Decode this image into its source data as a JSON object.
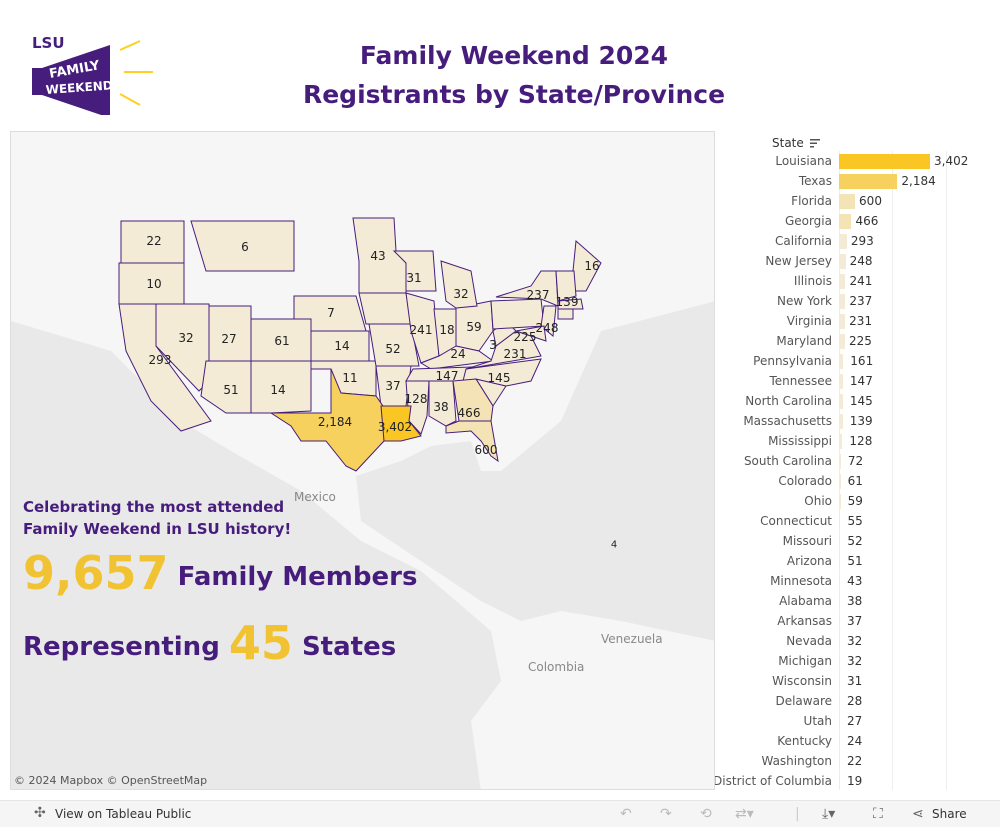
{
  "logo": {
    "text_top": "LSU",
    "text_mid": "FAMILY",
    "text_bot": "WEEKEND",
    "color": "#461d7c",
    "accent": "#fdd023"
  },
  "title": {
    "line1": "Family Weekend 2024",
    "line2": "Registrants by State/Province"
  },
  "map": {
    "labels": [
      {
        "state": "Washington",
        "value": "22"
      },
      {
        "state": "Oregon",
        "value": "10"
      },
      {
        "state": "Montana",
        "value": "6"
      },
      {
        "state": "Minnesota",
        "value": "43"
      },
      {
        "state": "Wisconsin",
        "value": "31"
      },
      {
        "state": "Michigan",
        "value": "32"
      },
      {
        "state": "New York",
        "value": "237"
      },
      {
        "state": "Maine",
        "value": "16"
      },
      {
        "state": "Massachusetts",
        "value": "139"
      },
      {
        "state": "California",
        "value": "293"
      },
      {
        "state": "Nevada",
        "value": "32"
      },
      {
        "state": "Utah",
        "value": "27"
      },
      {
        "state": "Colorado",
        "value": "61"
      },
      {
        "state": "Nebraska",
        "value": "7"
      },
      {
        "state": "Kansas",
        "value": "14"
      },
      {
        "state": "Missouri",
        "value": "52"
      },
      {
        "state": "Illinois",
        "value": "241"
      },
      {
        "state": "Indiana",
        "value": "18"
      },
      {
        "state": "Ohio",
        "value": "59"
      },
      {
        "state": "New Jersey",
        "value": "248"
      },
      {
        "state": "Maryland",
        "value": "225"
      },
      {
        "state": "West Virginia",
        "value": "3"
      },
      {
        "state": "Virginia",
        "value": "231"
      },
      {
        "state": "Kentucky",
        "value": "24"
      },
      {
        "state": "Arizona",
        "value": "51"
      },
      {
        "state": "New Mexico",
        "value": "14"
      },
      {
        "state": "Oklahoma",
        "value": "11"
      },
      {
        "state": "Arkansas",
        "value": "37"
      },
      {
        "state": "Tennessee",
        "value": "147"
      },
      {
        "state": "North Carolina",
        "value": "145"
      },
      {
        "state": "Mississippi",
        "value": "128"
      },
      {
        "state": "Alabama",
        "value": "38"
      },
      {
        "state": "Georgia",
        "value": "466"
      },
      {
        "state": "Texas",
        "value": "2,184"
      },
      {
        "state": "Louisiana",
        "value": "3,402"
      },
      {
        "state": "Florida",
        "value": "600"
      },
      {
        "state": "Puerto Rico",
        "value": "4"
      }
    ],
    "places": {
      "mexico": "Mexico",
      "venezuela": "Venezuela",
      "colombia": "Colombia"
    },
    "attribution": "© 2024 Mapbox  © OpenStreetMap",
    "colors": {
      "max": "#f9c623",
      "high": "#f7d15e",
      "mid": "#f3e3b5",
      "low": "#f4ebd7",
      "border": "#461d7c"
    }
  },
  "overlay": {
    "celebrate_line1": "Celebrating the most attended",
    "celebrate_line2": "Family Weekend in LSU history!",
    "members_count": "9,657",
    "members_label": "Family Members",
    "representing": "Representing",
    "states_count": "45",
    "states_label": "States"
  },
  "chart_data": {
    "type": "bar",
    "orientation": "horizontal",
    "header": "State",
    "xlim": [
      0,
      4500
    ],
    "gridlines": [
      2000,
      4000
    ],
    "categories": [
      "Louisiana",
      "Texas",
      "Florida",
      "Georgia",
      "California",
      "New Jersey",
      "Illinois",
      "New York",
      "Virginia",
      "Maryland",
      "Pennsylvania",
      "Tennessee",
      "North Carolina",
      "Massachusetts",
      "Mississippi",
      "South Carolina",
      "Colorado",
      "Ohio",
      "Connecticut",
      "Missouri",
      "Arizona",
      "Minnesota",
      "Alabama",
      "Arkansas",
      "Nevada",
      "Michigan",
      "Wisconsin",
      "Delaware",
      "Utah",
      "Kentucky",
      "Washington",
      "District of Columbia"
    ],
    "values": [
      3402,
      2184,
      600,
      466,
      293,
      248,
      241,
      237,
      231,
      225,
      161,
      147,
      145,
      139,
      128,
      72,
      61,
      59,
      55,
      52,
      51,
      43,
      38,
      37,
      32,
      32,
      31,
      28,
      27,
      24,
      22,
      19
    ],
    "labels": [
      "3,402",
      "2,184",
      "600",
      "466",
      "293",
      "248",
      "241",
      "237",
      "231",
      "225",
      "161",
      "147",
      "145",
      "139",
      "128",
      "72",
      "61",
      "59",
      "55",
      "52",
      "51",
      "43",
      "38",
      "37",
      "32",
      "32",
      "31",
      "28",
      "27",
      "24",
      "22",
      "19"
    ]
  },
  "toolbar": {
    "view_label": "View on Tableau Public",
    "share_label": "Share"
  }
}
